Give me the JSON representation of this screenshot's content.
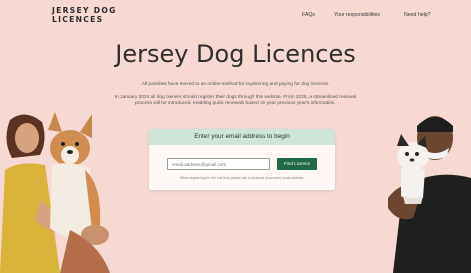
{
  "header": {
    "logo_line1": "JERSEY DOG",
    "logo_line2": "LICENCES",
    "nav": [
      "FAQs",
      "Your responsibilities",
      "Need help?"
    ]
  },
  "main": {
    "title": "Jersey Dog Licences",
    "intro_line1": "All parishes have moved to an online method for registering and paying for dog licences.",
    "intro_line2": "In January 2024 all dog owners should register their dogs through this website. From 2025, a streamlined renewal process will be introduced, enabling quick renewals based on your previous year's information."
  },
  "email_card": {
    "heading": "Enter your email address to begin",
    "placeholder": "email.address@gmail.com",
    "button_label": "Find Licence",
    "helper_text": "When registering for the first time please use a personal (non-work) email address."
  },
  "colors": {
    "background": "#f6d9d3",
    "card_header": "#cfe5d9",
    "button": "#1f6a45"
  }
}
